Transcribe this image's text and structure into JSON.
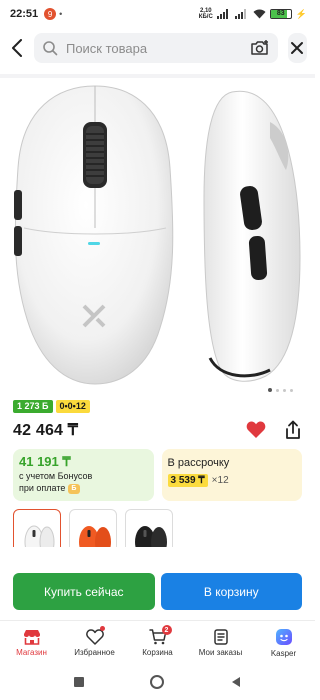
{
  "status_bar": {
    "time": "22:51",
    "notification_count": "9",
    "net_speed_value": "2,10",
    "net_speed_unit": "КБ/С",
    "battery": "83",
    "battery_level": 0.83
  },
  "search": {
    "placeholder": "Поиск товара",
    "back_icon": "chevron-left-icon",
    "camera_icon": "camera-search-icon",
    "close_icon": "close-icon"
  },
  "gallery": {
    "current_page": 1,
    "total_pages": 4
  },
  "badges": {
    "bonus": "1 273 Б",
    "installment": "0•0•12"
  },
  "product": {
    "price": "42 464 ₸",
    "favorite_icon": "heart-icon",
    "share_icon": "share-icon"
  },
  "bonus_card": {
    "price": "41 191 ₸",
    "line1": "с учетом Бонусов",
    "line2": "при оплате",
    "coin_icon": "bonus-coin-icon"
  },
  "credit_card": {
    "title": "В рассрочку",
    "monthly": "3 539 ₸",
    "months": "×12"
  },
  "variants": [
    {
      "color": "white",
      "selected": true
    },
    {
      "color": "orange",
      "selected": false
    },
    {
      "color": "black",
      "selected": false
    }
  ],
  "buttons": {
    "buy_now": "Купить сейчас",
    "add_to_cart": "В корзину"
  },
  "bottom_nav": {
    "items": [
      {
        "label": "Магазин",
        "icon": "shop-icon",
        "active": true
      },
      {
        "label": "Избранное",
        "icon": "heart-icon",
        "active": false
      },
      {
        "label": "Корзина",
        "icon": "cart-icon",
        "active": false,
        "badge": "2"
      },
      {
        "label": "Мои заказы",
        "icon": "orders-icon",
        "active": false
      },
      {
        "label": "Kasper",
        "icon": "kasper-icon",
        "active": false
      }
    ]
  },
  "colors": {
    "accent_red": "#e0393e",
    "buy_green": "#2da142",
    "cart_blue": "#1a81e4",
    "bonus_green": "#37a32b",
    "credit_yellow": "#fbdb3e"
  }
}
